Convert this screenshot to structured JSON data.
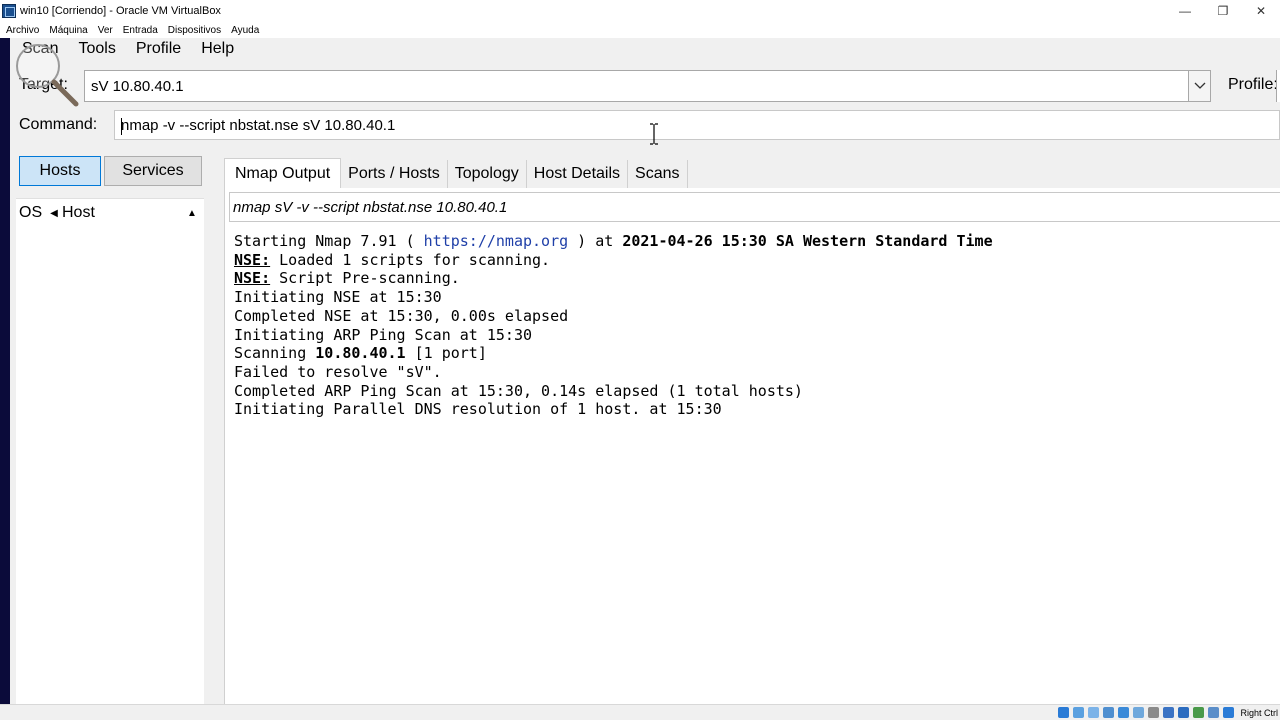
{
  "vbox": {
    "title": "win10 [Corriendo] - Oracle VM VirtualBox",
    "menus": [
      "Archivo",
      "Máquina",
      "Ver",
      "Entrada",
      "Dispositivos",
      "Ayuda"
    ],
    "host_key": "Right Ctrl",
    "status_icon_colors": [
      "#2a7bd6",
      "#5aa0e0",
      "#7cb3e8",
      "#4f8fd0",
      "#3b8ad8",
      "#6fa8dc",
      "#8a8a8a",
      "#3b73c4",
      "#2c6cbf",
      "#4a9a4a",
      "#5b8ec9",
      "#2a7bd6"
    ]
  },
  "zenmap": {
    "menu": {
      "scan": "Scan",
      "tools": "Tools",
      "profile": "Profile",
      "help": "Help"
    },
    "target_label": "Target:",
    "target_value": "sV 10.80.40.1",
    "profile_label": "Profile:",
    "command_label": "Command:",
    "command_value": "nmap -v --script nbstat.nse sV 10.80.40.1",
    "hosts_button": "Hosts",
    "services_button": "Services",
    "hostlist": {
      "col_os": "OS",
      "col_host": "Host"
    },
    "tabs": [
      "Nmap Output",
      "Ports / Hosts",
      "Topology",
      "Host Details",
      "Scans"
    ],
    "output_command": "nmap sV -v --script nbstat.nse 10.80.40.1",
    "output": {
      "l1_prefix": "Starting Nmap 7.91 ( ",
      "l1_link": "https://nmap.org",
      "l1_mid": " ) at ",
      "l1_date": "2021-04-26 15:30",
      "l1_suffix": " SA Western Standard Time",
      "l2_label": "NSE:",
      "l2_text": " Loaded 1 scripts for scanning.",
      "l3_label": "NSE:",
      "l3_text": " Script Pre-scanning.",
      "l4": "Initiating NSE at 15:30",
      "l5": "Completed NSE at 15:30, 0.00s elapsed",
      "l6": "Initiating ARP Ping Scan at 15:30",
      "l7_prefix": "Scanning ",
      "l7_ip": "10.80.40.1",
      "l7_suffix": " [1 port]",
      "l8": "Failed to resolve \"sV\".",
      "l9": "Completed ARP Ping Scan at 15:30, 0.14s elapsed (1 total hosts)",
      "l10": "Initiating Parallel DNS resolution of 1 host. at 15:30"
    }
  }
}
